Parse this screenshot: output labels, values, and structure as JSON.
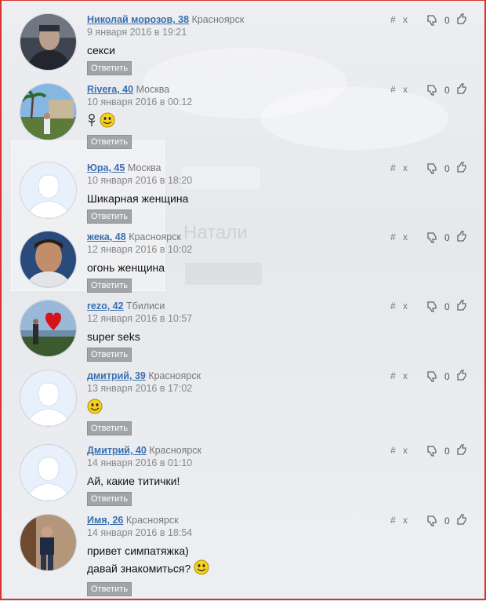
{
  "reply_label": "Ответить",
  "icons": {
    "permalink": "#",
    "delete": "x",
    "dislike": "thumbs-down-icon",
    "like": "thumbs-up-icon",
    "smiley": "smiley-icon",
    "flower": "flower-icon"
  },
  "colors": {
    "username": "#3a6fb0",
    "reply_button": "#a2a5a8",
    "border": "#d9352e"
  },
  "background": {
    "ghost_name": "Натали"
  },
  "comments": [
    {
      "name": "Николай морозов, 38",
      "city": "Красноярск",
      "date": "9 января 2016 в 19:21",
      "lines": [
        "секси"
      ],
      "score": "0",
      "avatar": "photo-man-dark"
    },
    {
      "name": "Rivera, 40",
      "city": "Москва",
      "date": "10 января 2016 в 00:12",
      "lines": [
        ""
      ],
      "score": "0",
      "avatar": "photo-palms"
    },
    {
      "name": "Юра, 45",
      "city": "Москва",
      "date": "10 января 2016 в 18:20",
      "lines": [
        "Шикарная женщина"
      ],
      "score": "0",
      "avatar": "default"
    },
    {
      "name": "жека, 48",
      "city": "Красноярск",
      "date": "12 января 2016 в 10:02",
      "lines": [
        "огонь женщина"
      ],
      "score": "0",
      "avatar": "photo-man-face"
    },
    {
      "name": "rezo, 42",
      "city": "Тбилиси",
      "date": "12 января 2016 в 10:57",
      "lines": [
        "super seks"
      ],
      "score": "0",
      "avatar": "photo-heart"
    },
    {
      "name": "дмитрий, 39",
      "city": "Красноярск",
      "date": "13 января 2016 в 17:02",
      "lines": [
        ""
      ],
      "score": "0",
      "avatar": "default"
    },
    {
      "name": "Дмитрий, 40",
      "city": "Красноярск",
      "date": "14 января 2016 в 01:10",
      "lines": [
        "Ай, какие титички!"
      ],
      "score": "0",
      "avatar": "default"
    },
    {
      "name": "Имя, 26",
      "city": "Красноярск",
      "date": "14 января 2016 в 18:54",
      "lines": [
        "привет симпатяжка)",
        "давай знакомиться?"
      ],
      "score": "0",
      "avatar": "photo-man-standing"
    }
  ]
}
